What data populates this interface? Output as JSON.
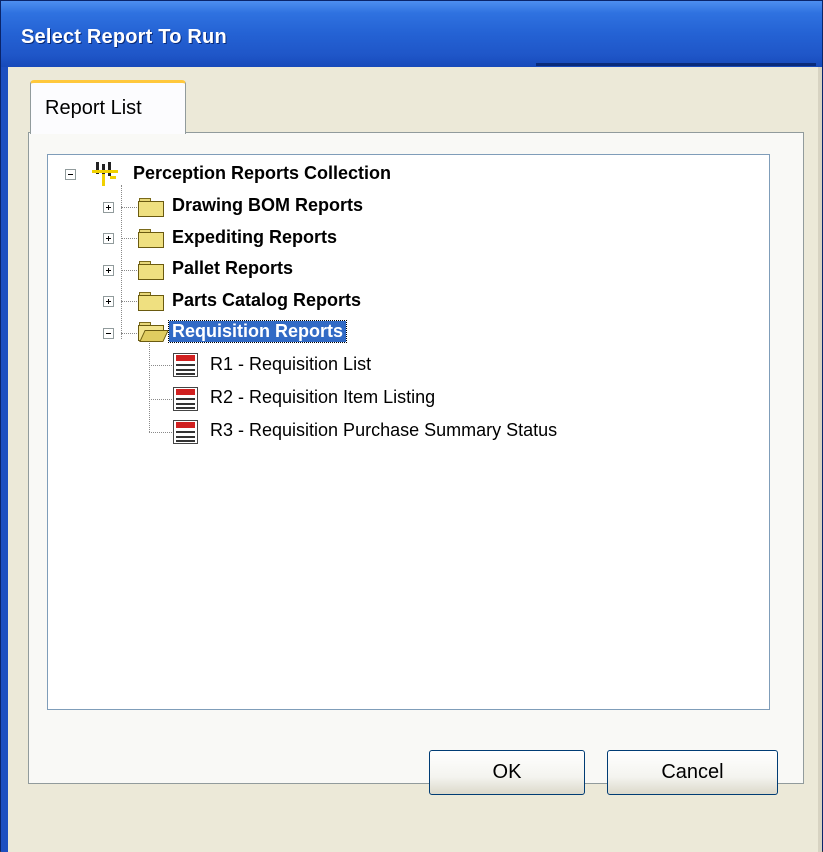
{
  "dialog": {
    "title": "Select Report To Run"
  },
  "tabs": [
    {
      "label": "Report List"
    }
  ],
  "tree": {
    "root": {
      "label": "Perception Reports Collection"
    },
    "folders": [
      {
        "label": "Drawing BOM Reports",
        "expanded": false
      },
      {
        "label": "Expediting Reports",
        "expanded": false
      },
      {
        "label": "Pallet Reports",
        "expanded": false
      },
      {
        "label": "Parts Catalog Reports",
        "expanded": false
      },
      {
        "label": "Requisition Reports",
        "expanded": true,
        "selected": true
      }
    ],
    "reports": [
      {
        "label": "R1 - Requisition List"
      },
      {
        "label": "R2 - Requisition Item Listing"
      },
      {
        "label": "R3 - Requisition Purchase Summary Status"
      }
    ]
  },
  "buttons": {
    "ok": "OK",
    "cancel": "Cancel"
  },
  "colors": {
    "selection": "#316ac5",
    "title_bar": "#2462d4",
    "tab_accent": "#ffc83c"
  }
}
